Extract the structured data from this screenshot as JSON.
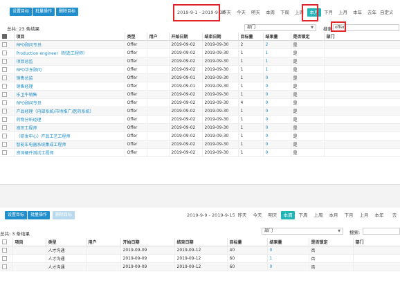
{
  "panel1": {
    "toolbar": {
      "set_target": "设置目标",
      "batch_op": "批量操作",
      "delete_target": "删除目标"
    },
    "date_range": "2019-9-1 - 2019-9-30",
    "periods": [
      "昨天",
      "今天",
      "明天",
      "本周",
      "下周",
      "上周",
      "本月",
      "下月",
      "上月",
      "本年",
      "去年",
      "自定义"
    ],
    "active_period": "本月",
    "total": "总共: 23 条结果",
    "dept_label": "部门",
    "search_label": "搜索:",
    "search_value": "offer",
    "columns": [
      "项目",
      "类型",
      "用户",
      "开始日期",
      "结束日期",
      "目标量",
      "结果量",
      "是否锁定",
      "部门"
    ],
    "rows": [
      {
        "project": "RPO顾问专员",
        "type": "Offer",
        "user": "",
        "start": "2019-09-02",
        "end": "2019-09-30",
        "target": "2",
        "result": "2",
        "locked": "是",
        "dept": ""
      },
      {
        "project": "Production engineer（制造工程师）",
        "type": "Offer",
        "user": "",
        "start": "2019-09-02",
        "end": "2019-09-30",
        "target": "1",
        "result": "1",
        "locked": "是",
        "dept": ""
      },
      {
        "project": "项目总监",
        "type": "Offer",
        "user": "",
        "start": "2019-09-02",
        "end": "2019-09-30",
        "target": "1",
        "result": "1",
        "locked": "是",
        "dept": ""
      },
      {
        "project": "RPO华东顾问",
        "type": "Offer",
        "user": "",
        "start": "2019-09-02",
        "end": "2019-09-30",
        "target": "1",
        "result": "1",
        "locked": "是",
        "dept": ""
      },
      {
        "project": "销售总监",
        "type": "Offer",
        "user": "",
        "start": "2019-09-01",
        "end": "2019-09-30",
        "target": "1",
        "result": "0",
        "locked": "是",
        "dept": ""
      },
      {
        "project": "销售经理",
        "type": "Offer",
        "user": "",
        "start": "2019-09-01",
        "end": "2019-09-30",
        "target": "1",
        "result": "0",
        "locked": "是",
        "dept": ""
      },
      {
        "project": "乐卫牛销售",
        "type": "Offer",
        "user": "",
        "start": "2019-09-02",
        "end": "2019-09-30",
        "target": "1",
        "result": "0",
        "locked": "是",
        "dept": ""
      },
      {
        "project": "RPO顾问专员",
        "type": "Offer",
        "user": "",
        "start": "2019-09-02",
        "end": "2019-09-30",
        "target": "4",
        "result": "0",
        "locked": "是",
        "dept": ""
      },
      {
        "project": "产品经理（内部系统/市场推广/医药系统）",
        "type": "Offer",
        "user": "",
        "start": "2019-09-02",
        "end": "2019-09-30",
        "target": "1",
        "result": "0",
        "locked": "是",
        "dept": ""
      },
      {
        "project": "药物分析经理",
        "type": "Offer",
        "user": "",
        "start": "2019-09-02",
        "end": "2019-09-30",
        "target": "1",
        "result": "0",
        "locked": "是",
        "dept": ""
      },
      {
        "project": "液压工程师",
        "type": "Offer",
        "user": "",
        "start": "2019-09-02",
        "end": "2019-09-30",
        "target": "1",
        "result": "0",
        "locked": "是",
        "dept": ""
      },
      {
        "project": "（研发中心）产品工艺工程师",
        "type": "Offer",
        "user": "",
        "start": "2019-09-02",
        "end": "2019-09-30",
        "target": "1",
        "result": "0",
        "locked": "是",
        "dept": ""
      },
      {
        "project": "智能车电器系统集成工程师",
        "type": "Offer",
        "user": "",
        "start": "2019-09-02",
        "end": "2019-09-30",
        "target": "1",
        "result": "0",
        "locked": "是",
        "dept": ""
      },
      {
        "project": "资深硬件测试工程师",
        "type": "Offer",
        "user": "",
        "start": "2019-09-02",
        "end": "2019-09-30",
        "target": "1",
        "result": "0",
        "locked": "是",
        "dept": ""
      }
    ]
  },
  "panel2": {
    "toolbar": {
      "set_target": "设置目标",
      "batch_op": "批量操作",
      "delete_target": "删除目标"
    },
    "date_range": "2019-9-9 - 2019-9-15",
    "periods": [
      "昨天",
      "今天",
      "明天",
      "本周",
      "下周",
      "上周",
      "本月",
      "下月",
      "上月",
      "本年",
      "去"
    ],
    "active_period": "本周",
    "total": "总共: 3 条结果",
    "dept_label": "部门",
    "search_label": "搜索:",
    "search_value": "",
    "columns": [
      "项目",
      "类型",
      "用户",
      "开始日期",
      "结束日期",
      "目标量",
      "结果量",
      "是否锁定",
      "部门"
    ],
    "rows": [
      {
        "project": "",
        "type": "人才沟通",
        "user": "",
        "start": "2019-09-09",
        "end": "2019-09-12",
        "target": "40",
        "result": "0",
        "locked": "否",
        "dept": ""
      },
      {
        "project": "",
        "type": "人才沟通",
        "user": "",
        "start": "2019-09-09",
        "end": "2019-09-12",
        "target": "60",
        "result": "1",
        "locked": "否",
        "dept": ""
      },
      {
        "project": "",
        "type": "人才沟通",
        "user": "",
        "start": "2019-09-09",
        "end": "2019-09-12",
        "target": "60",
        "result": "0",
        "locked": "否",
        "dept": ""
      }
    ]
  },
  "colors": {
    "primary_button": "#1f8ecb",
    "active_period": "#22b4b7",
    "highlight_box": "#e0262b",
    "link_text": "#1f8ecb"
  }
}
